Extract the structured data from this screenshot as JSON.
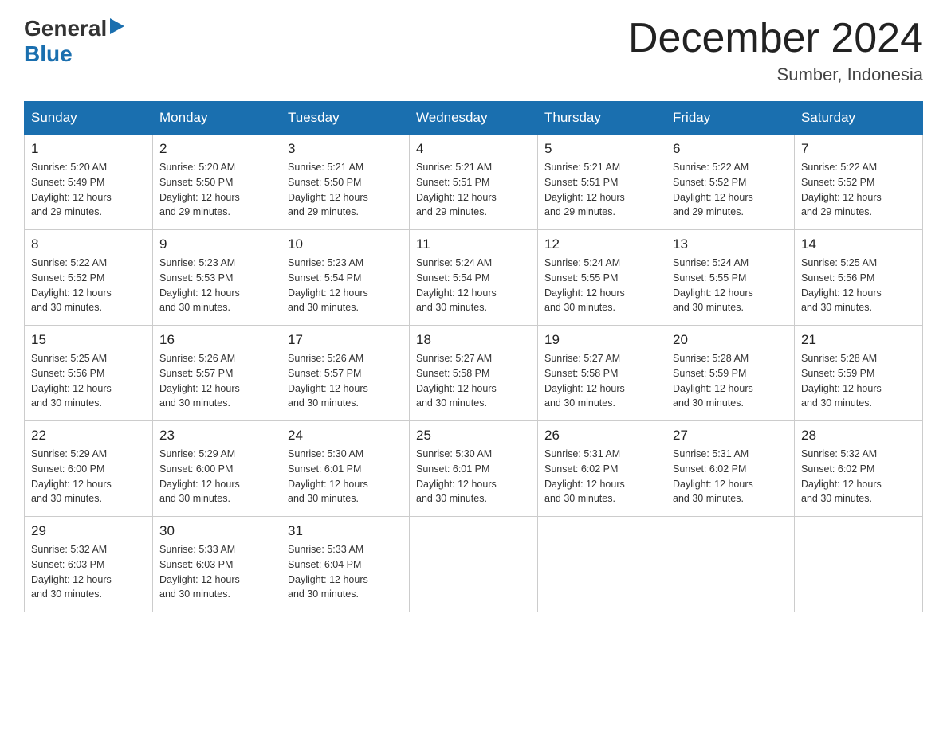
{
  "header": {
    "month_title": "December 2024",
    "location": "Sumber, Indonesia",
    "logo_general": "General",
    "logo_blue": "Blue"
  },
  "days_of_week": [
    "Sunday",
    "Monday",
    "Tuesday",
    "Wednesday",
    "Thursday",
    "Friday",
    "Saturday"
  ],
  "weeks": [
    [
      {
        "day": "1",
        "sunrise": "5:20 AM",
        "sunset": "5:49 PM",
        "daylight": "12 hours and 29 minutes."
      },
      {
        "day": "2",
        "sunrise": "5:20 AM",
        "sunset": "5:50 PM",
        "daylight": "12 hours and 29 minutes."
      },
      {
        "day": "3",
        "sunrise": "5:21 AM",
        "sunset": "5:50 PM",
        "daylight": "12 hours and 29 minutes."
      },
      {
        "day": "4",
        "sunrise": "5:21 AM",
        "sunset": "5:51 PM",
        "daylight": "12 hours and 29 minutes."
      },
      {
        "day": "5",
        "sunrise": "5:21 AM",
        "sunset": "5:51 PM",
        "daylight": "12 hours and 29 minutes."
      },
      {
        "day": "6",
        "sunrise": "5:22 AM",
        "sunset": "5:52 PM",
        "daylight": "12 hours and 29 minutes."
      },
      {
        "day": "7",
        "sunrise": "5:22 AM",
        "sunset": "5:52 PM",
        "daylight": "12 hours and 29 minutes."
      }
    ],
    [
      {
        "day": "8",
        "sunrise": "5:22 AM",
        "sunset": "5:52 PM",
        "daylight": "12 hours and 30 minutes."
      },
      {
        "day": "9",
        "sunrise": "5:23 AM",
        "sunset": "5:53 PM",
        "daylight": "12 hours and 30 minutes."
      },
      {
        "day": "10",
        "sunrise": "5:23 AM",
        "sunset": "5:54 PM",
        "daylight": "12 hours and 30 minutes."
      },
      {
        "day": "11",
        "sunrise": "5:24 AM",
        "sunset": "5:54 PM",
        "daylight": "12 hours and 30 minutes."
      },
      {
        "day": "12",
        "sunrise": "5:24 AM",
        "sunset": "5:55 PM",
        "daylight": "12 hours and 30 minutes."
      },
      {
        "day": "13",
        "sunrise": "5:24 AM",
        "sunset": "5:55 PM",
        "daylight": "12 hours and 30 minutes."
      },
      {
        "day": "14",
        "sunrise": "5:25 AM",
        "sunset": "5:56 PM",
        "daylight": "12 hours and 30 minutes."
      }
    ],
    [
      {
        "day": "15",
        "sunrise": "5:25 AM",
        "sunset": "5:56 PM",
        "daylight": "12 hours and 30 minutes."
      },
      {
        "day": "16",
        "sunrise": "5:26 AM",
        "sunset": "5:57 PM",
        "daylight": "12 hours and 30 minutes."
      },
      {
        "day": "17",
        "sunrise": "5:26 AM",
        "sunset": "5:57 PM",
        "daylight": "12 hours and 30 minutes."
      },
      {
        "day": "18",
        "sunrise": "5:27 AM",
        "sunset": "5:58 PM",
        "daylight": "12 hours and 30 minutes."
      },
      {
        "day": "19",
        "sunrise": "5:27 AM",
        "sunset": "5:58 PM",
        "daylight": "12 hours and 30 minutes."
      },
      {
        "day": "20",
        "sunrise": "5:28 AM",
        "sunset": "5:59 PM",
        "daylight": "12 hours and 30 minutes."
      },
      {
        "day": "21",
        "sunrise": "5:28 AM",
        "sunset": "5:59 PM",
        "daylight": "12 hours and 30 minutes."
      }
    ],
    [
      {
        "day": "22",
        "sunrise": "5:29 AM",
        "sunset": "6:00 PM",
        "daylight": "12 hours and 30 minutes."
      },
      {
        "day": "23",
        "sunrise": "5:29 AM",
        "sunset": "6:00 PM",
        "daylight": "12 hours and 30 minutes."
      },
      {
        "day": "24",
        "sunrise": "5:30 AM",
        "sunset": "6:01 PM",
        "daylight": "12 hours and 30 minutes."
      },
      {
        "day": "25",
        "sunrise": "5:30 AM",
        "sunset": "6:01 PM",
        "daylight": "12 hours and 30 minutes."
      },
      {
        "day": "26",
        "sunrise": "5:31 AM",
        "sunset": "6:02 PM",
        "daylight": "12 hours and 30 minutes."
      },
      {
        "day": "27",
        "sunrise": "5:31 AM",
        "sunset": "6:02 PM",
        "daylight": "12 hours and 30 minutes."
      },
      {
        "day": "28",
        "sunrise": "5:32 AM",
        "sunset": "6:02 PM",
        "daylight": "12 hours and 30 minutes."
      }
    ],
    [
      {
        "day": "29",
        "sunrise": "5:32 AM",
        "sunset": "6:03 PM",
        "daylight": "12 hours and 30 minutes."
      },
      {
        "day": "30",
        "sunrise": "5:33 AM",
        "sunset": "6:03 PM",
        "daylight": "12 hours and 30 minutes."
      },
      {
        "day": "31",
        "sunrise": "5:33 AM",
        "sunset": "6:04 PM",
        "daylight": "12 hours and 30 minutes."
      },
      null,
      null,
      null,
      null
    ]
  ],
  "labels": {
    "sunrise": "Sunrise:",
    "sunset": "Sunset:",
    "daylight": "Daylight:"
  }
}
